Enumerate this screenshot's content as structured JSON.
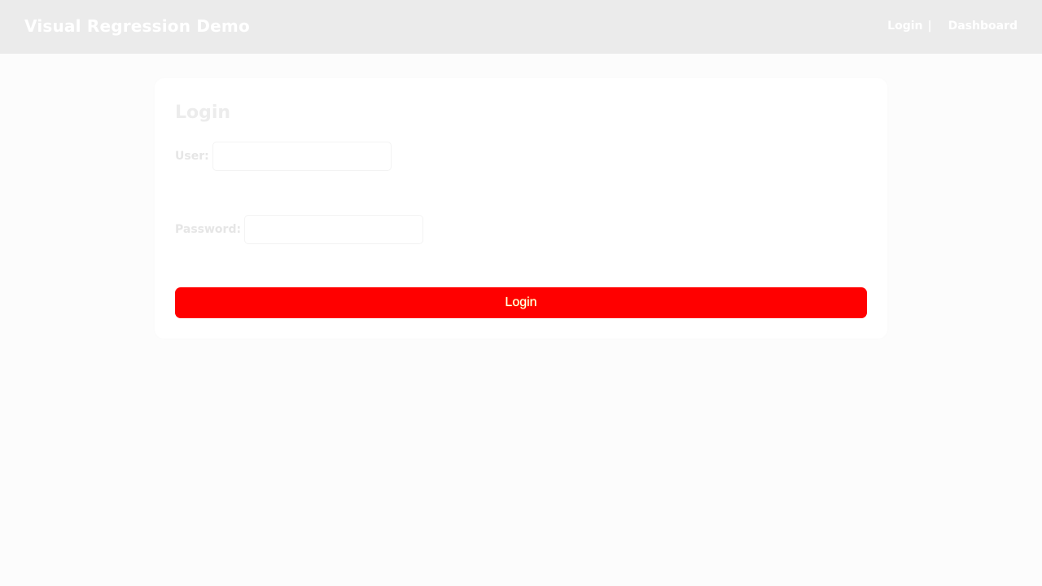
{
  "header": {
    "title": "Visual Regression Demo",
    "nav": {
      "login_label": "Login",
      "separator": "|",
      "dashboard_label": "Dashboard"
    }
  },
  "login_form": {
    "heading": "Login",
    "user_label": "User:",
    "user_value": "",
    "password_label": "Password:",
    "password_value": "",
    "submit_label": "Login"
  },
  "colors": {
    "header_bg": "#ebebeb",
    "page_bg": "#fcfcfc",
    "button_bg": "#ff0000",
    "button_text": "#ffffff"
  }
}
